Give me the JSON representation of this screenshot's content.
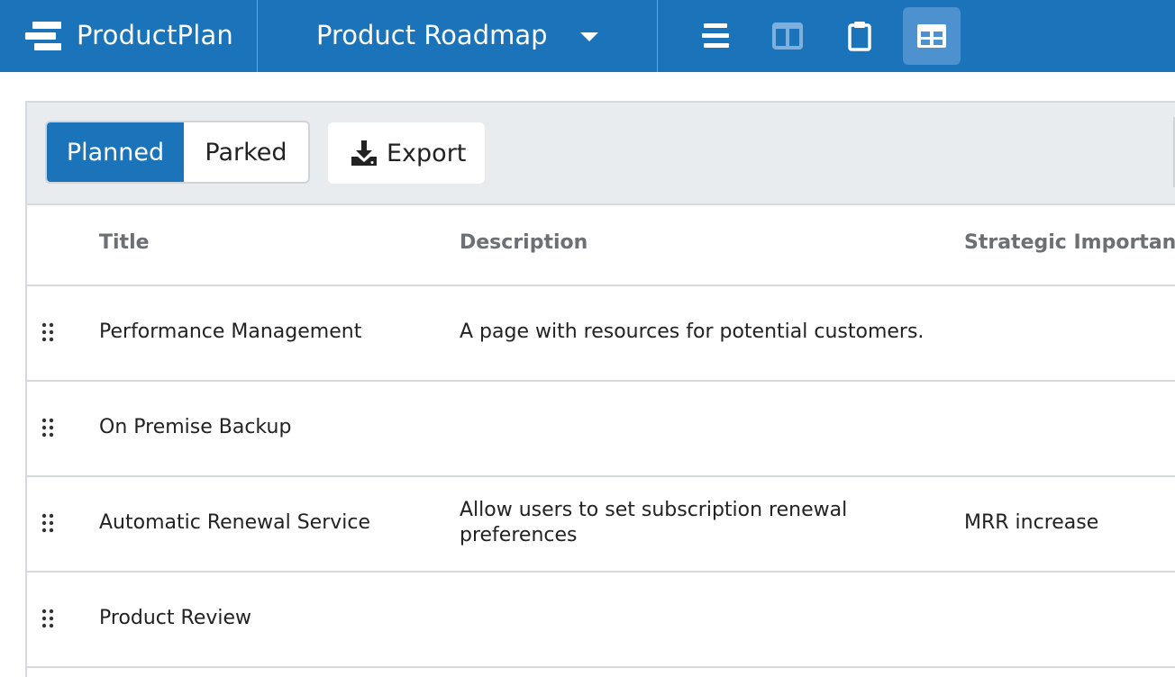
{
  "header": {
    "brand_name": "ProductPlan",
    "roadmap_title": "Product Roadmap",
    "views": [
      {
        "name": "list-view",
        "icon": "bars-icon",
        "active": false
      },
      {
        "name": "board-view",
        "icon": "columns-icon",
        "active": false
      },
      {
        "name": "clipboard-view",
        "icon": "clipboard-icon",
        "active": false
      },
      {
        "name": "table-view",
        "icon": "table-icon",
        "active": true
      }
    ]
  },
  "toolbar": {
    "tabs": [
      {
        "label": "Planned",
        "selected": true
      },
      {
        "label": "Parked",
        "selected": false
      }
    ],
    "export_label": "Export"
  },
  "table": {
    "columns": [
      "Title",
      "Description",
      "Strategic Importance"
    ],
    "rows": [
      {
        "title": "Performance Management",
        "description": "A page with resources for potential customers.",
        "strategic_importance": ""
      },
      {
        "title": "On Premise Backup",
        "description": "",
        "strategic_importance": ""
      },
      {
        "title": "Automatic Renewal Service",
        "description": "Allow users to set subscription renewal preferences",
        "strategic_importance": "MRR increase"
      },
      {
        "title": "Product Review",
        "description": "",
        "strategic_importance": ""
      }
    ]
  },
  "colors": {
    "accent": "#1b73ba",
    "active_view_bg": "#4d92cf",
    "toolbar_bg": "#e8ecef",
    "divider": "#d7dadd"
  }
}
